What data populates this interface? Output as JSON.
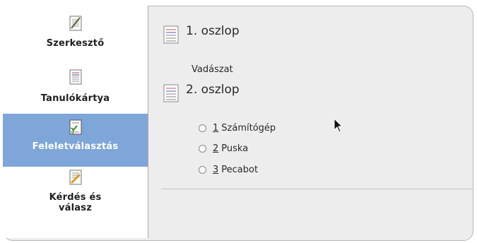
{
  "sidebar": {
    "items": [
      {
        "label": "Szerkesztő",
        "icon": "edit-icon",
        "active": false
      },
      {
        "label": "Tanulókártya",
        "icon": "flashcard-icon",
        "active": false
      },
      {
        "label": "Feleletválasztás",
        "icon": "multiple-choice-icon",
        "active": true
      },
      {
        "label": "Kérdés és válasz",
        "label_line1": "Kérdés és",
        "label_line2": "válasz",
        "icon": "question-answer-icon",
        "active": false
      }
    ]
  },
  "main": {
    "column1": {
      "title": "1. oszlop",
      "answer": "Vadászat"
    },
    "column2": {
      "title": "2. oszlop",
      "options": [
        {
          "num": "1",
          "text": "Számítógép"
        },
        {
          "num": "2",
          "text": "Puska"
        },
        {
          "num": "3",
          "text": "Pecabot"
        }
      ]
    }
  },
  "colors": {
    "accent": "#7fa6d8",
    "background": "#ededed"
  }
}
